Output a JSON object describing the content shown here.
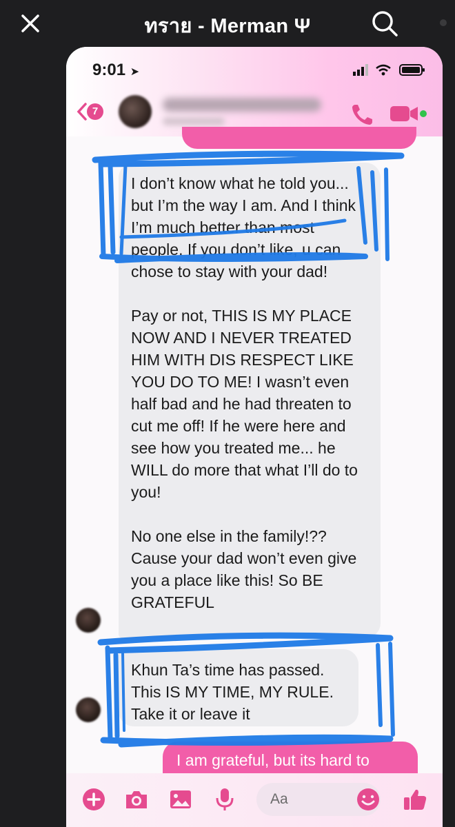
{
  "viewer": {
    "title": "ทราย - Merman Ψ",
    "close_icon": "close-icon",
    "search_icon": "search-icon"
  },
  "status_bar": {
    "time": "9:01",
    "icons": [
      "location-arrow-icon",
      "signal-icon",
      "wifi-icon",
      "battery-icon"
    ]
  },
  "chat_header": {
    "back_badge": "7",
    "icons": [
      "chevron-left-icon",
      "phone-icon",
      "video-icon"
    ],
    "accent": "#e54b8f"
  },
  "messages": {
    "received_1": [
      "I don’t know what he told you... but I’m the way I am. And I think I’m much better than most people.  If you don’t like, u can chose to stay with your dad!",
      "Pay or not, THIS IS MY PLACE NOW AND I NEVER TREATED HIM WITH DIS RESPECT LIKE YOU DO TO ME!  I wasn’t even half bad and he had threaten to cut me off! If he were here and see how you treated me... he WILL do more that what I’ll do to you!",
      "No one else in the family!?? Cause your dad won’t even give you a place like this! So BE GRATEFUL"
    ],
    "received_2": "Khun Ta’s time has passed. This IS MY TIME, MY RULE. Take it or leave it",
    "sent_partial": "I am grateful, but its hard to"
  },
  "composer": {
    "placeholder": "Aa",
    "icons": [
      "plus-icon",
      "camera-icon",
      "image-icon",
      "microphone-icon",
      "emoji-icon",
      "thumbs-up-icon"
    ]
  },
  "colors": {
    "sent_bubble": "#f25ea9",
    "received_bubble": "#ececef",
    "marker": "#1f7ae6",
    "viewer_background": "#1e1e20"
  }
}
